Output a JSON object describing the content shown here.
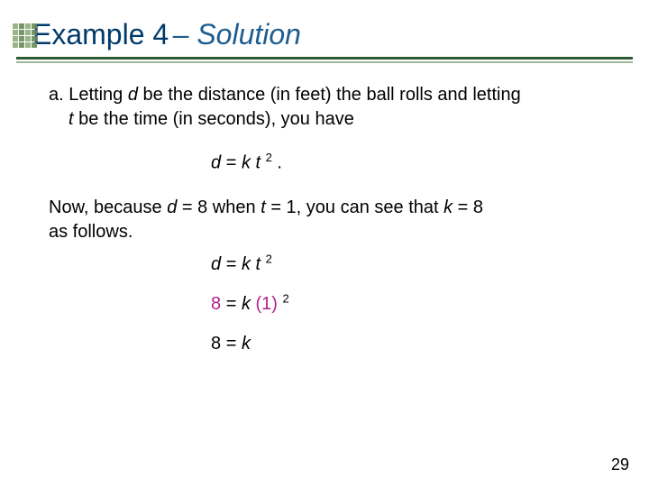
{
  "title": {
    "example": "Example 4",
    "dash": " – ",
    "solution": "Solution"
  },
  "partA": {
    "label": "a.",
    "line1a": " Letting ",
    "d": "d",
    "line1b": " be the distance (in feet) the ball rolls and letting",
    "t": "t",
    "line2": " be the time (in seconds), you have",
    "eq1_lhs": "d",
    "eq1_mid": " = ",
    "eq1_k": "k",
    "eq1_t": "t",
    "eq1_exp": "2",
    "eq1_end": ".",
    "now1": "Now, because ",
    "now_d": "d",
    "now2": " = 8 when ",
    "now_t": "t",
    "now3": " = 1, you can see that ",
    "now_k": "k",
    "now4": " = 8",
    "now5": "as follows.",
    "eq2_lhs": "d",
    "eq2_eq": " = ",
    "eq2_k": "k",
    "eq2_t": "t",
    "eq2_exp": "2",
    "eq3_lhs": "8",
    "eq3_eq": " = ",
    "eq3_k": "k",
    "eq3_paren": "(1)",
    "eq3_exp": "2",
    "eq4_lhs": "8",
    "eq4_eq": " = ",
    "eq4_k": "k"
  },
  "page": "29"
}
